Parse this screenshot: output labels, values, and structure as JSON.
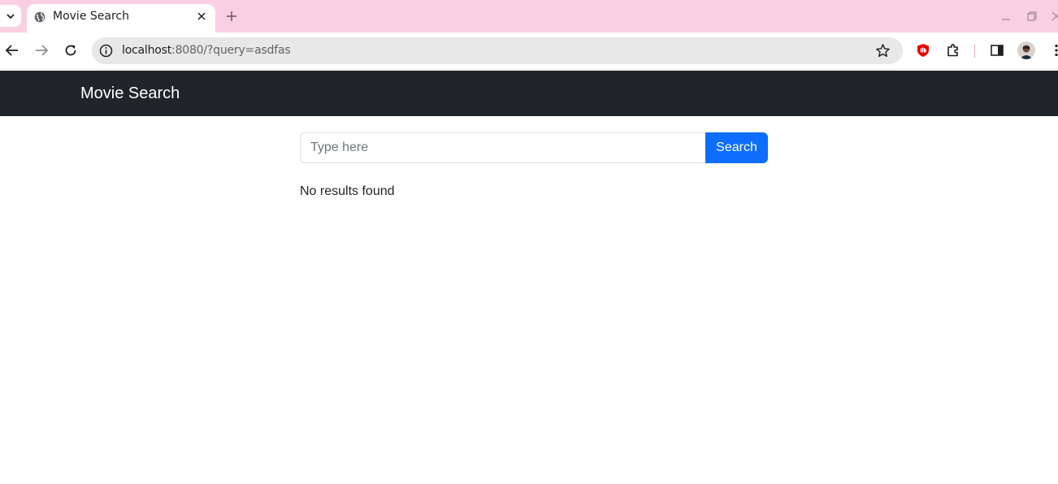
{
  "browser": {
    "tab": {
      "title": "Movie Search"
    },
    "address": {
      "host": "localhost",
      "rest": ":8080/?query=asdfas"
    }
  },
  "navbar": {
    "brand": "Movie Search"
  },
  "search": {
    "placeholder": "Type here",
    "value": "",
    "button_label": "Search"
  },
  "results": {
    "message": "No results found"
  },
  "colors": {
    "tabstrip": "#f9cfe2",
    "navbar": "#212529",
    "primary": "#0d6efd"
  },
  "icons": [
    "tab-search-icon",
    "globe-icon",
    "close-icon",
    "plus-icon",
    "minimize-icon",
    "restore-icon",
    "back-arrow-icon",
    "forward-arrow-icon",
    "reload-icon",
    "info-icon",
    "star-icon",
    "extension-shield-icon",
    "puzzle-icon",
    "side-panel-icon",
    "avatar",
    "kebab-menu-icon"
  ]
}
